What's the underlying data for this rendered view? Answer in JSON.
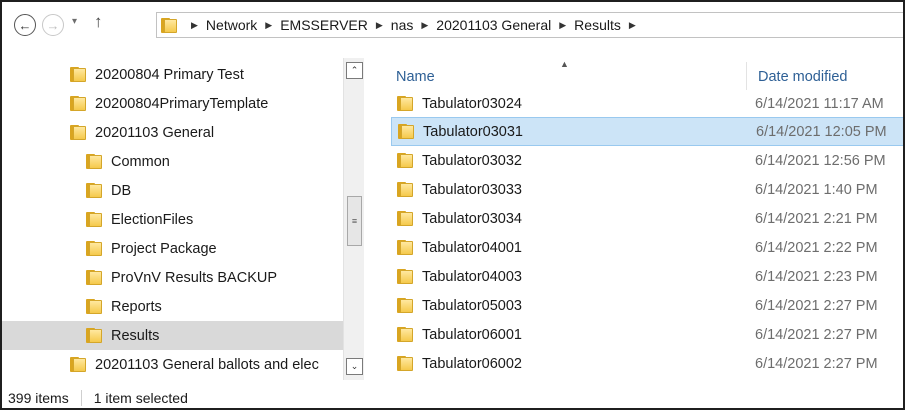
{
  "address_bar": {
    "crumbs": [
      "Network",
      "EMSSERVER",
      "nas",
      "20201103 General",
      "Results"
    ]
  },
  "nav": {
    "back_glyph": "←",
    "forward_glyph": "→",
    "history_glyph": "▾",
    "up_glyph": "↑"
  },
  "tree": {
    "items": [
      {
        "label": "20200804 Primary Test",
        "depth": 0,
        "selected": false
      },
      {
        "label": "20200804PrimaryTemplate",
        "depth": 0,
        "selected": false
      },
      {
        "label": "20201103 General",
        "depth": 0,
        "selected": false
      },
      {
        "label": "Common",
        "depth": 1,
        "selected": false
      },
      {
        "label": "DB",
        "depth": 1,
        "selected": false
      },
      {
        "label": "ElectionFiles",
        "depth": 1,
        "selected": false
      },
      {
        "label": "Project Package",
        "depth": 1,
        "selected": false
      },
      {
        "label": "ProVnV Results BACKUP",
        "depth": 1,
        "selected": false
      },
      {
        "label": "Reports",
        "depth": 1,
        "selected": false
      },
      {
        "label": "Results",
        "depth": 1,
        "selected": true
      },
      {
        "label": "20201103 General ballots and elec",
        "depth": 0,
        "selected": false
      }
    ]
  },
  "list": {
    "columns": {
      "name": "Name",
      "date_modified": "Date modified"
    },
    "rows": [
      {
        "name": "Tabulator03024",
        "date": "6/14/2021 11:17 AM",
        "selected": false
      },
      {
        "name": "Tabulator03031",
        "date": "6/14/2021 12:05 PM",
        "selected": true
      },
      {
        "name": "Tabulator03032",
        "date": "6/14/2021 12:56 PM",
        "selected": false
      },
      {
        "name": "Tabulator03033",
        "date": "6/14/2021 1:40 PM",
        "selected": false
      },
      {
        "name": "Tabulator03034",
        "date": "6/14/2021 2:21 PM",
        "selected": false
      },
      {
        "name": "Tabulator04001",
        "date": "6/14/2021 2:22 PM",
        "selected": false
      },
      {
        "name": "Tabulator04003",
        "date": "6/14/2021 2:23 PM",
        "selected": false
      },
      {
        "name": "Tabulator05003",
        "date": "6/14/2021 2:27 PM",
        "selected": false
      },
      {
        "name": "Tabulator06001",
        "date": "6/14/2021 2:27 PM",
        "selected": false
      },
      {
        "name": "Tabulator06002",
        "date": "6/14/2021 2:27 PM",
        "selected": false
      }
    ]
  },
  "status_bar": {
    "item_count": "399 items",
    "selection": "1 item selected"
  },
  "colors": {
    "selected_row_bg": "#cce4f7",
    "selected_row_border": "#99c9ef",
    "selected_tree_bg": "#d9d9d9",
    "column_header_text": "#2d5f95",
    "folder_yellow": "#f5c94b"
  },
  "icons": {
    "folder": "folder-icon",
    "back": "back-arrow-icon",
    "forward": "forward-arrow-icon",
    "up": "up-arrow-icon",
    "crumb_separator": "chevron-right-icon"
  }
}
